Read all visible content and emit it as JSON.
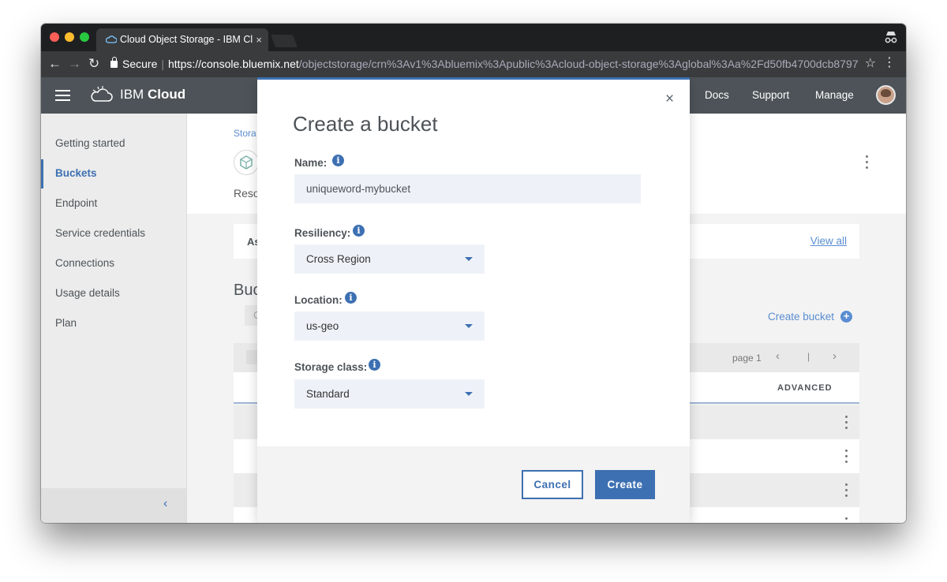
{
  "browser": {
    "tab_title": "Cloud Object Storage - IBM Cl",
    "tab_close": "×",
    "secure_label": "Secure",
    "url_scheme_host": "https://console.bluemix.net",
    "url_path": "/objectstorage/crn%3Av1%3Abluemix%3Apublic%3Acloud-object-storage%3Aglobal%3Aa%2Fd50fb4700dcb8797f..."
  },
  "header": {
    "brand_prefix": "IBM",
    "brand_suffix": "Cloud",
    "links": {
      "docs": "Docs",
      "support": "Support",
      "manage": "Manage"
    }
  },
  "sidebar": {
    "items": [
      {
        "label": "Getting started"
      },
      {
        "label": "Buckets"
      },
      {
        "label": "Endpoint"
      },
      {
        "label": "Service credentials"
      },
      {
        "label": "Connections"
      },
      {
        "label": "Usage details"
      },
      {
        "label": "Plan"
      }
    ],
    "active_index": 1,
    "collapse_glyph": "‹"
  },
  "background": {
    "breadcrumb": "Stora",
    "resource_label": "Reso",
    "assets_label": "As",
    "view_all": "View all",
    "buckets_heading": "Buc",
    "filter_fragment": "C",
    "create_bucket_link": "Create bucket",
    "pagination": {
      "page_label": "page 1",
      "separator": "|"
    },
    "advanced_header": "ADVANCED"
  },
  "modal": {
    "title": "Create a bucket",
    "close_glyph": "×",
    "name": {
      "label": "Name:",
      "value": "uniqueword-mybucket"
    },
    "resiliency": {
      "label": "Resiliency:",
      "value": "Cross Region"
    },
    "location": {
      "label": "Location:",
      "value": "us-geo"
    },
    "storage_class": {
      "label": "Storage class:",
      "value": "Standard"
    },
    "buttons": {
      "cancel": "Cancel",
      "create": "Create"
    }
  },
  "colors": {
    "accent": "#3d70b2",
    "header_bg": "#4d5358",
    "field_bg": "#eef2f8",
    "link": "#5a8dd1"
  }
}
